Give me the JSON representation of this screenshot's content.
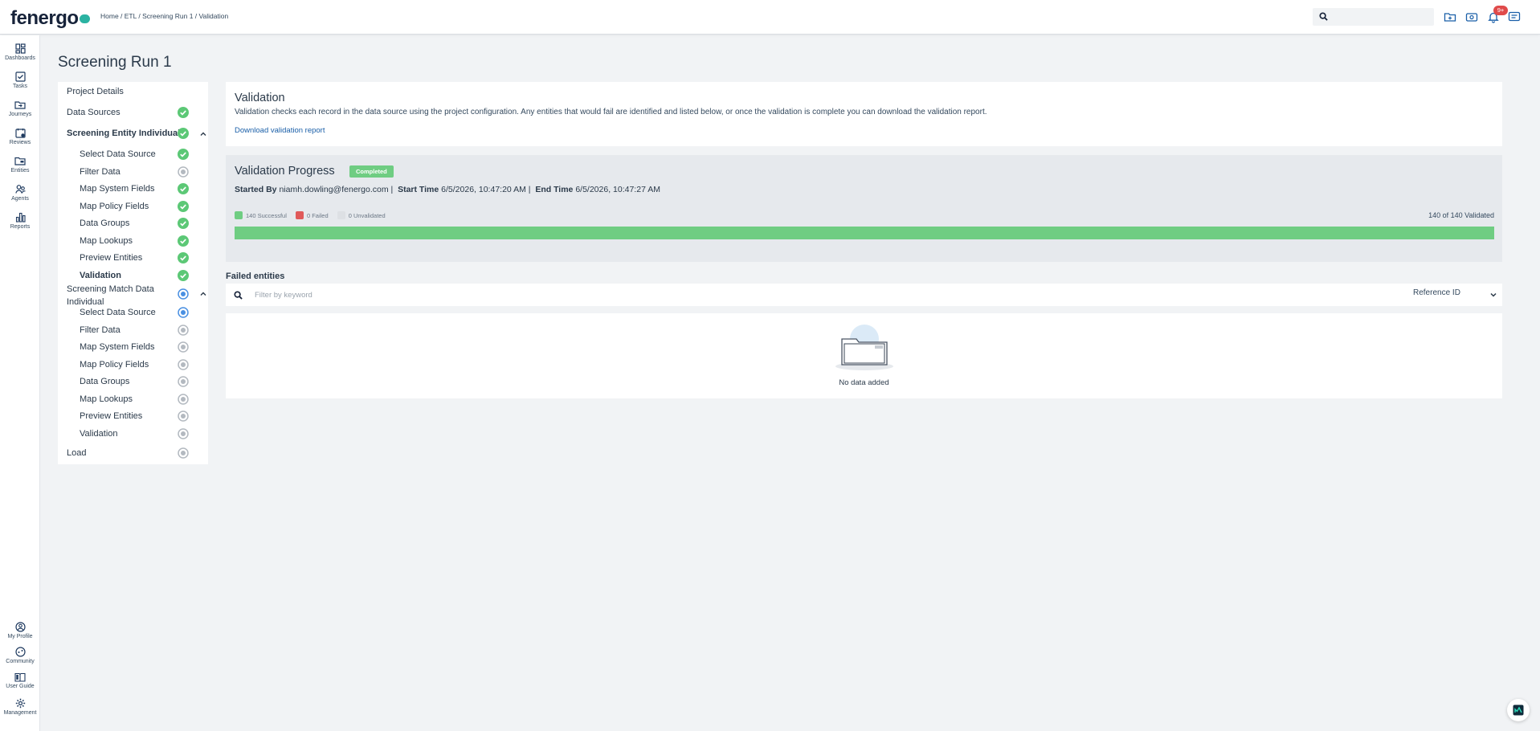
{
  "brand": {
    "logo_text": "fenergo",
    "accent_color": "#2bb3a2"
  },
  "header": {
    "breadcrumb": "Home / ETL / Screening Run 1 / Validation",
    "search_placeholder": "",
    "notification_badge": "9+",
    "icons": [
      "folder-icon",
      "inbox-icon",
      "bell-icon",
      "chat-icon"
    ]
  },
  "nav": {
    "top": [
      {
        "label": "Dashboards",
        "icon": "dashboard-icon"
      },
      {
        "label": "Tasks",
        "icon": "tasks-icon"
      },
      {
        "label": "Journeys",
        "icon": "journeys-icon"
      },
      {
        "label": "Reviews",
        "icon": "reviews-icon"
      },
      {
        "label": "Entities",
        "icon": "entities-icon"
      },
      {
        "label": "Agents",
        "icon": "agents-icon"
      },
      {
        "label": "Reports",
        "icon": "reports-icon"
      }
    ],
    "bottom": [
      {
        "label": "My Profile",
        "icon": "profile-icon"
      },
      {
        "label": "Community",
        "icon": "community-icon"
      },
      {
        "label": "User Guide",
        "icon": "guide-icon"
      },
      {
        "label": "Management",
        "icon": "gear-icon"
      }
    ]
  },
  "page_title": "Screening Run 1",
  "steps": {
    "project_details": "Project Details",
    "data_sources": "Data Sources",
    "group1": {
      "title": "Screening Entity Individual",
      "items": [
        "Select Data Source",
        "Filter Data",
        "Map System Fields",
        "Map Policy Fields",
        "Data Groups",
        "Map Lookups",
        "Preview Entities",
        "Validation"
      ]
    },
    "group2": {
      "title_line1": "Screening Match Data",
      "title_line2": "Individual",
      "items": [
        "Select Data Source",
        "Filter Data",
        "Map System Fields",
        "Map Policy Fields",
        "Data Groups",
        "Map Lookups",
        "Preview Entities",
        "Validation"
      ]
    },
    "load": "Load"
  },
  "validation": {
    "title": "Validation",
    "description": "Validation checks each record in the data source using the project configuration. Any entities that would fail are identified and listed below, or once the validation is complete you can download the validation report.",
    "download_link": "Download validation report"
  },
  "progress": {
    "title": "Validation Progress",
    "status": "Completed",
    "started_by_label": "Started By",
    "started_by": "niamh.dowling@fenergo.com",
    "start_time_label": "Start Time",
    "start_time": "6/5/2026, 10:47:20 AM",
    "end_time_label": "End Time",
    "end_time": "6/5/2026, 10:47:27 AM",
    "legend": {
      "successful": "140 Successful",
      "failed": "0 Failed",
      "unvalidated": "0 Unvalidated"
    },
    "validated_text": "140 of 140 Validated",
    "fraction_complete": 1.0,
    "colors": {
      "success": "#6fcd82",
      "failed": "#e05a5a",
      "unvalidated": "#d4d8dd"
    }
  },
  "failed_entities": {
    "title": "Failed entities",
    "filter_placeholder": "Filter by keyword",
    "sort_field": "Reference ID",
    "empty_text": "No data added"
  }
}
